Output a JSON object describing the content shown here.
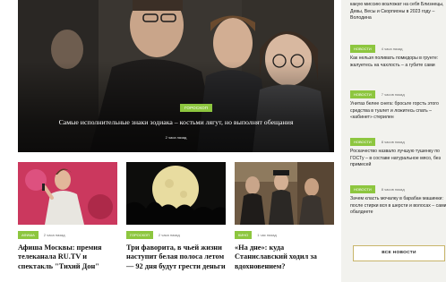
{
  "hero": {
    "tag": "ГОРОСКОП",
    "title": "Самые исполнительные знаки зодиака – костьми лягут, но выполнят обещания",
    "time": "2 часа назад"
  },
  "cards": [
    {
      "tag": "АФИША",
      "time": "2 часа назад",
      "title": "Афиша Москвы: премия телеканала RU.TV и спектакль \"Тихий Дон\""
    },
    {
      "tag": "ГОРОСКОП",
      "time": "2 часа назад",
      "title": "Три фаворита, в чьей жизни наступит белая полоса летом — 92 дня будут грести деньги"
    },
    {
      "tag": "КИНО",
      "time": "1 час назад",
      "title": "«На дне»: куда Станиславский ходил за вдохновением?"
    }
  ],
  "sidebar": {
    "top_text": "какую миссию возложат на себя Близнецы, Девы, Весы и Скорпионы в 2023 году – Володина",
    "items": [
      {
        "tag": "НОВОСТИ",
        "time": "4 часа назад",
        "text": "Как нельзя поливать помидоры в грунте: жалуетесь на чахлость – а губите сами"
      },
      {
        "tag": "НОВОСТИ",
        "time": "7 часов назад",
        "text": "Унитаз белее снега: бросьте горсть этого средства в туалет и ложитесь спать – «кабинет» стерилен"
      },
      {
        "tag": "НОВОСТИ",
        "time": "8 часов назад",
        "text": "Роскачество назвало лучшую тушенку по ГОСТу – в составе натуральное мясо, без примесей"
      },
      {
        "tag": "НОВОСТИ",
        "time": "8 часов назад",
        "text": "Зачем класть мочалку в барабан машинки: после стирки вся в шерсти и волосах – сами обалдеете"
      }
    ],
    "all_news": "ВСЕ НОВОСТИ"
  }
}
